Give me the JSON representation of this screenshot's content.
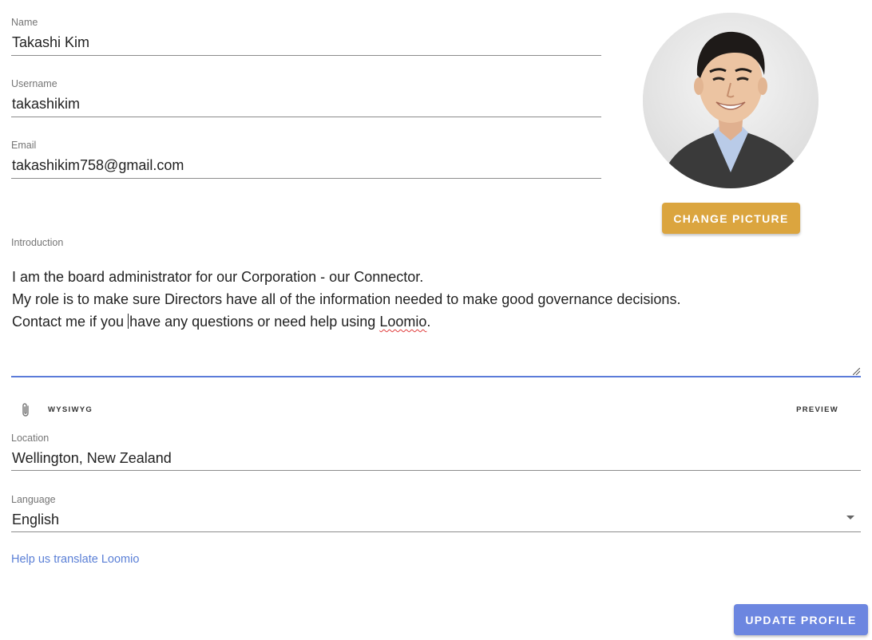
{
  "profile": {
    "name_label": "Name",
    "name_value": "Takashi Kim",
    "username_label": "Username",
    "username_value": "takashikim",
    "email_label": "Email",
    "email_value": "takashikim758@gmail.com",
    "intro_label": "Introduction",
    "intro_line1": "I am the board administrator for our Corporation - our Connector.",
    "intro_line2": "My role is to make sure Directors have all of the information needed to make good governance decisions.",
    "intro_line3_a": "Contact me if you ",
    "intro_line3_b": "have any questions or need help using ",
    "intro_line3_spell": "Loomio",
    "intro_line3_end": ".",
    "location_label": "Location",
    "location_value": "Wellington, New Zealand",
    "language_label": "Language",
    "language_value": "English"
  },
  "avatar": {
    "icon": "user-photo",
    "alt": "Profile picture"
  },
  "buttons": {
    "change_picture": "Change picture",
    "update_profile": "Update profile"
  },
  "editor_toolbar": {
    "attach_icon": "paperclip-icon",
    "wysiwyg": "WYSIWYG",
    "preview": "PREVIEW"
  },
  "links": {
    "help_translate": "Help us translate Loomio"
  },
  "colors": {
    "accent_gold": "#dba53f",
    "accent_blue": "#6c86e0",
    "link_blue": "#5a7fd6",
    "focus_underline": "#5b7bd9"
  }
}
